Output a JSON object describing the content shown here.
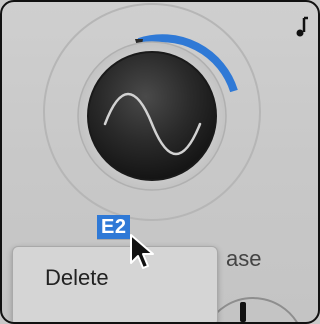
{
  "knob": {
    "value_label": "E2",
    "icon": "sine-wave-icon",
    "accent_color": "#2f79d6",
    "level": 0.23
  },
  "adjacent_label": {
    "text": "ase"
  },
  "context_menu": {
    "items": [
      {
        "label": "Delete"
      }
    ]
  },
  "header": {
    "icon": "note-icon"
  },
  "cursor": {
    "icon": "arrow-cursor-icon"
  }
}
